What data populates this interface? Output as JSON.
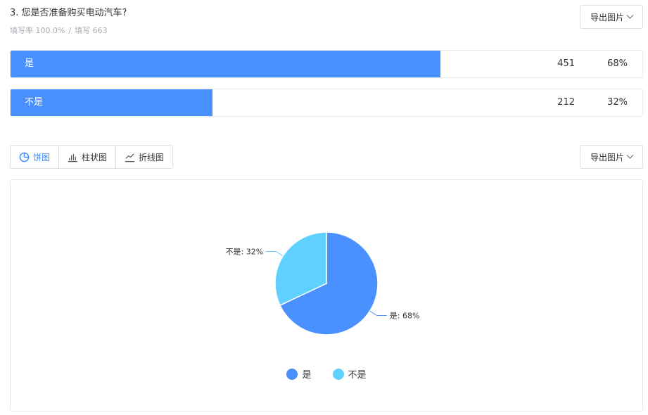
{
  "question": {
    "title": "3. 您是否准备购买电动汽车?",
    "fill_rate_label": "填写率 100.0%",
    "fill_count_label": "填写 663",
    "separator": "/"
  },
  "export_label": "导出图片",
  "answers": [
    {
      "label": "是",
      "count": "451",
      "percent": "68%",
      "fraction": 0.68
    },
    {
      "label": "不是",
      "count": "212",
      "percent": "32%",
      "fraction": 0.32
    }
  ],
  "tabs": [
    {
      "label": "饼图",
      "icon": "pie-chart-icon",
      "active": true
    },
    {
      "label": "柱状图",
      "icon": "bar-chart-icon",
      "active": false
    },
    {
      "label": "折线图",
      "icon": "line-chart-icon",
      "active": false
    }
  ],
  "colors": {
    "accent": "#4a90ff",
    "slice_yes": "#4a90ff",
    "slice_no": "#5fd0ff",
    "tab_active": "#3a87f5"
  },
  "chart_data": {
    "type": "pie",
    "categories": [
      "是",
      "不是"
    ],
    "values": [
      68,
      32
    ],
    "slice_labels": [
      "是: 68%",
      "不是: 32%"
    ],
    "colors": [
      "#4a90ff",
      "#5fd0ff"
    ],
    "legend": [
      "是",
      "不是"
    ],
    "legend_position": "bottom"
  }
}
